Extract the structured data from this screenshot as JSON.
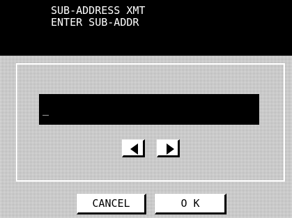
{
  "header": {
    "line1": "SUB-ADDRESS XMT",
    "line2": "ENTER SUB-ADDR"
  },
  "entry": {
    "value": "_"
  },
  "nav": {
    "left_icon": "left-triangle-icon",
    "right_icon": "right-triangle-icon"
  },
  "buttons": {
    "cancel_label": "CANCEL",
    "ok_label": "O K"
  },
  "colors": {
    "background_dither": "#9a9a9a",
    "header_bg": "#000000",
    "text_light": "#ffffff",
    "button_face": "#ffffff"
  }
}
